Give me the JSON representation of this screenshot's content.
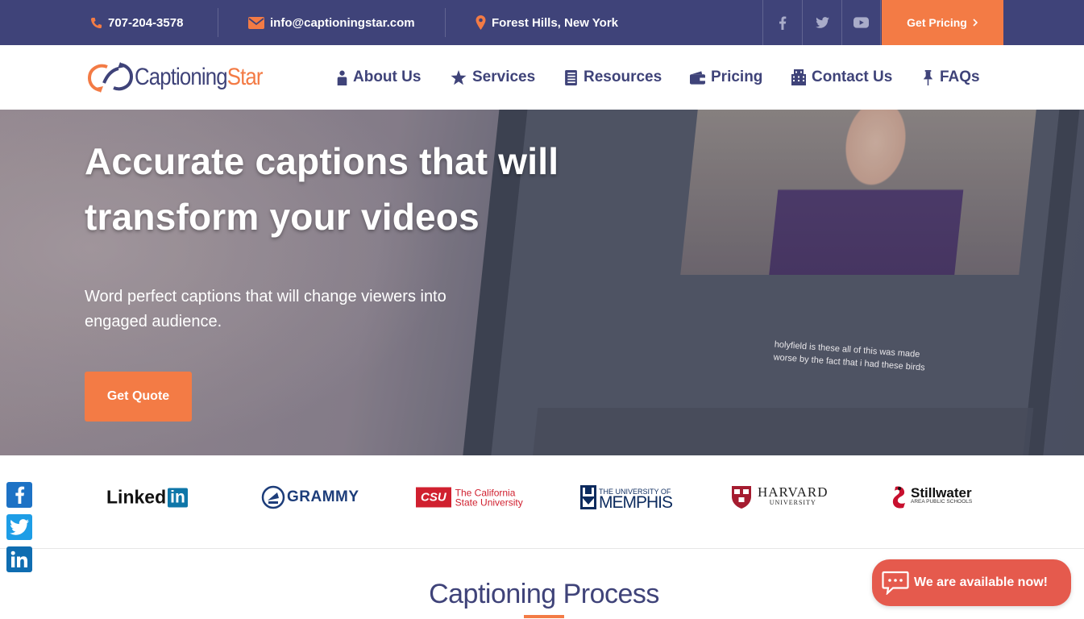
{
  "topbar": {
    "phone": "707-204-3578",
    "email": "info@captioningstar.com",
    "location": "Forest Hills, New York",
    "social": [
      "facebook-icon",
      "twitter-icon",
      "youtube-icon"
    ],
    "cta": "Get Pricing"
  },
  "logo": {
    "part1": "Captioning",
    "part2": "Star"
  },
  "nav": {
    "items": [
      {
        "label": "About Us",
        "icon": "person-icon"
      },
      {
        "label": "Services",
        "icon": "star-icon"
      },
      {
        "label": "Resources",
        "icon": "book-icon"
      },
      {
        "label": "Pricing",
        "icon": "wallet-icon"
      },
      {
        "label": "Contact Us",
        "icon": "building-icon"
      },
      {
        "label": "FAQs",
        "icon": "pin-icon"
      }
    ]
  },
  "hero": {
    "headline": "Accurate captions that will transform your videos",
    "subtext": "Word perfect captions that will change viewers into engaged audience.",
    "cta": "Get Quote",
    "video_caption_line1": "holyfield is these all of this was made",
    "video_caption_line2": "worse by the fact that i had these birds"
  },
  "clients": {
    "linkedin": {
      "word": "Linked",
      "box": "in"
    },
    "grammy": "GRAMMY",
    "csu": {
      "mark": "CSU",
      "line1": "The California",
      "line2": "State University"
    },
    "memphis": {
      "line1": "THE UNIVERSITY OF",
      "line2": "MEMPHIS"
    },
    "harvard": {
      "line1": "HARVARD",
      "line2": "UNIVERSITY"
    },
    "stillwater": {
      "line1": "Stillwater",
      "line2": "AREA PUBLIC SCHOOLS"
    }
  },
  "share": [
    "facebook-icon",
    "twitter-icon",
    "linkedin-icon"
  ],
  "section": {
    "title": "Captioning Process"
  },
  "chat": {
    "label": "We are available now!"
  },
  "colors": {
    "primary": "#3f4379",
    "accent": "#f37b45",
    "chat": "#e55a4d"
  }
}
